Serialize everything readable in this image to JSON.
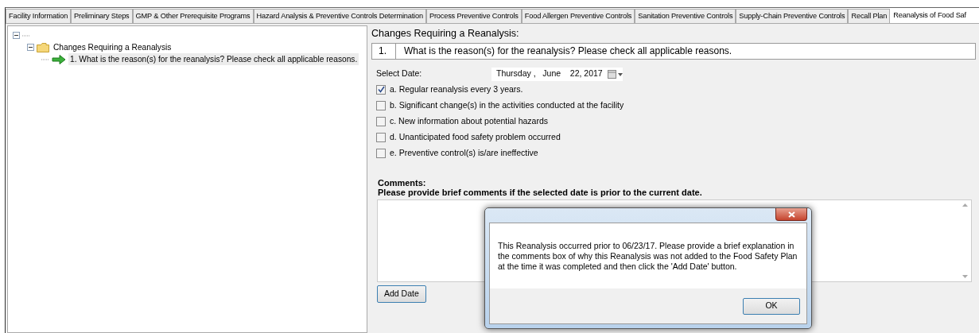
{
  "tabs": [
    {
      "label": "Facility Information",
      "selected": false
    },
    {
      "label": "Preliminary Steps",
      "selected": false
    },
    {
      "label": "GMP & Other Prerequisite Programs",
      "selected": false
    },
    {
      "label": "Hazard Analysis & Preventive Controls Determination",
      "selected": false
    },
    {
      "label": "Process Preventive Controls",
      "selected": false
    },
    {
      "label": "Food Allergen Preventive Controls",
      "selected": false
    },
    {
      "label": "Sanitation Preventive Controls",
      "selected": false
    },
    {
      "label": "Supply-Chain Preventive Controls",
      "selected": false
    },
    {
      "label": "Recall Plan",
      "selected": false
    },
    {
      "label": "Reanalysis of Food Saf",
      "selected": true
    }
  ],
  "tree": {
    "expanded": true,
    "children": [
      {
        "label": "Changes Requiring a Reanalysis",
        "expanded": true,
        "children": [
          {
            "label": "1.  What is the reason(s) for the reanalysis? Please check all applicable reasons.",
            "selected": true
          }
        ]
      }
    ]
  },
  "section_title": "Changes Requiring a Reanalysis:",
  "question": {
    "number": "1.",
    "text": "What is the reason(s) for the reanalysis? Please check all applicable reasons."
  },
  "date": {
    "label": "Select Date:",
    "value": "Thursday ,   June    22, 2017"
  },
  "reasons": [
    {
      "label": "a. Regular reanalysis every 3 years.",
      "checked": true
    },
    {
      "label": "b. Significant change(s) in the activities conducted at the facility",
      "checked": false
    },
    {
      "label": "c. New information about potential hazards",
      "checked": false
    },
    {
      "label": "d. Unanticipated food safety problem occurred",
      "checked": false
    },
    {
      "label": "e. Preventive control(s) is/are ineffective",
      "checked": false
    }
  ],
  "comments": {
    "label": "Comments:",
    "hint": "Please provide brief comments if the selected date is prior to the current date."
  },
  "add_button": "Add Date",
  "dialog": {
    "message": "This Reanalysis occurred prior to 06/23/17. Please provide a brief explanation in the comments box of why this Reanalysis was not added to the Food Safety Plan at the time it was completed and then click the 'Add Date' button.",
    "button": "OK"
  }
}
